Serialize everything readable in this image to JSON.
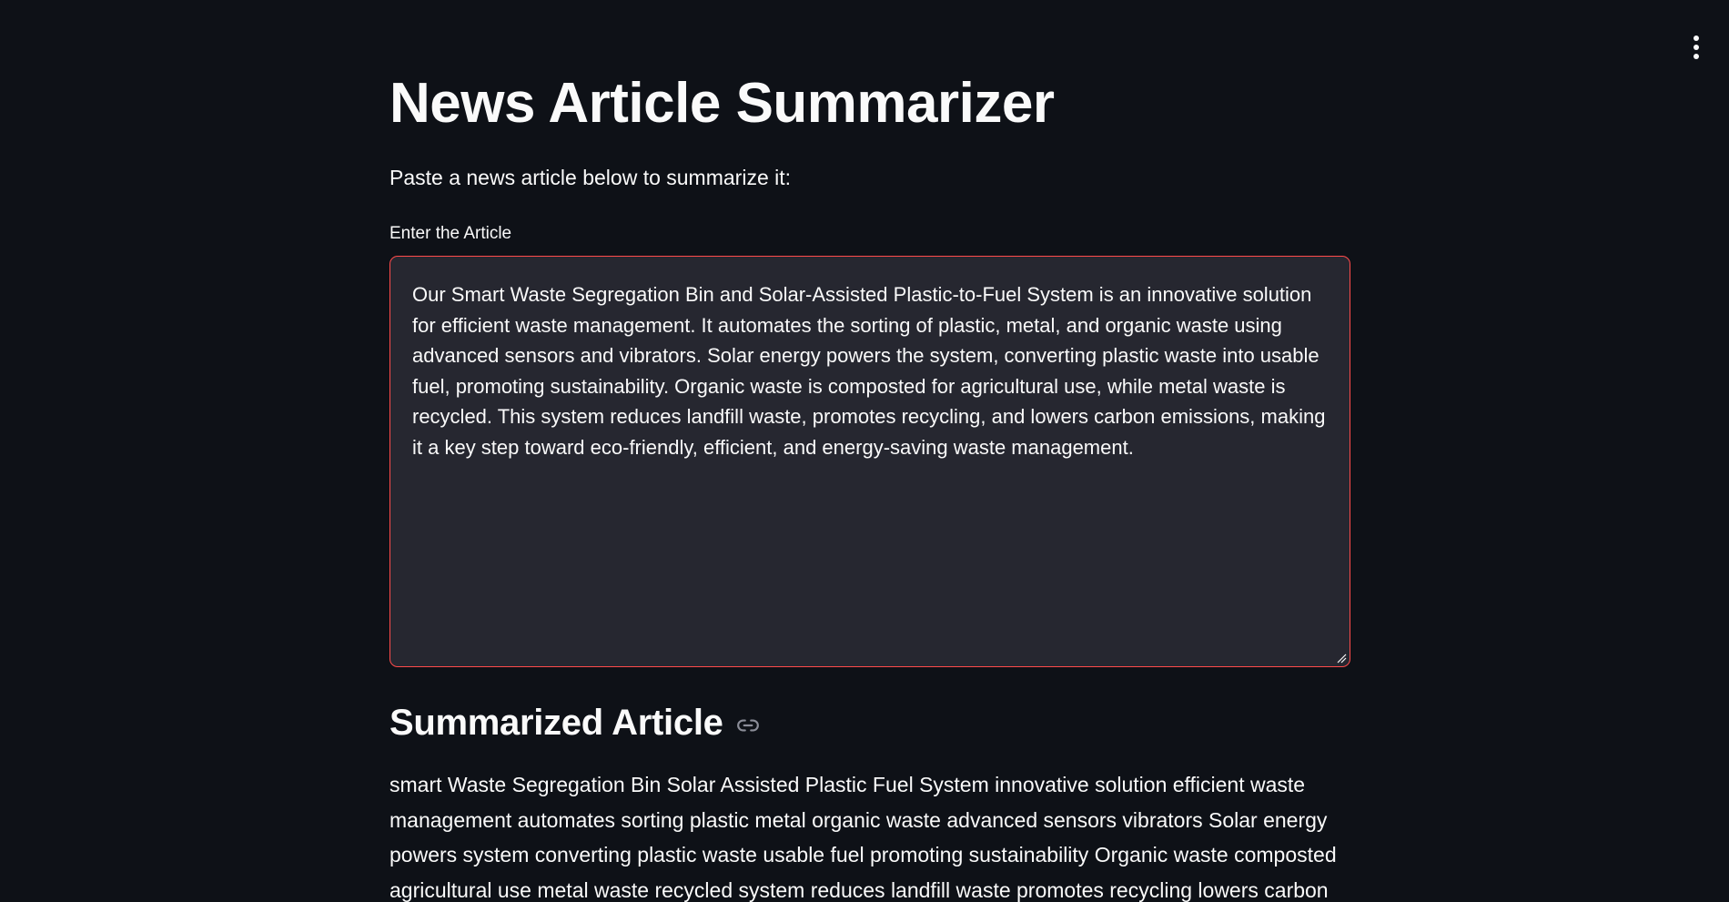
{
  "app": {
    "menu_icon": "kebab-menu-icon"
  },
  "header": {
    "title": "News Article Summarizer",
    "intro": "Paste a news article below to summarize it:"
  },
  "input": {
    "label": "Enter the Article",
    "value": "Our Smart Waste Segregation Bin and Solar-Assisted Plastic-to-Fuel System is an innovative solution for efficient waste management. It automates the sorting of plastic, metal, and organic waste using advanced sensors and vibrators. Solar energy powers the system, converting plastic waste into usable fuel, promoting sustainability. Organic waste is composted for agricultural use, while metal waste is recycled. This system reduces landfill waste, promotes recycling, and lowers carbon emissions, making it a key step toward eco-friendly, efficient, and energy-saving waste management.\n",
    "focus_border_color": "#ff4b4b"
  },
  "summary": {
    "heading": "Summarized Article",
    "link_icon": "link-icon",
    "text": "smart Waste Segregation Bin Solar Assisted Plastic Fuel System innovative solution efficient waste management automates sorting plastic metal organic waste advanced sensors vibrators Solar energy powers system converting plastic waste usable fuel promoting sustainability Organic waste composted agricultural use metal waste recycled system reduces landfill waste promotes recycling lowers carbon"
  },
  "colors": {
    "background": "#0e1117",
    "surface": "#262730",
    "text": "#fafafa",
    "accent": "#ff4b4b"
  }
}
